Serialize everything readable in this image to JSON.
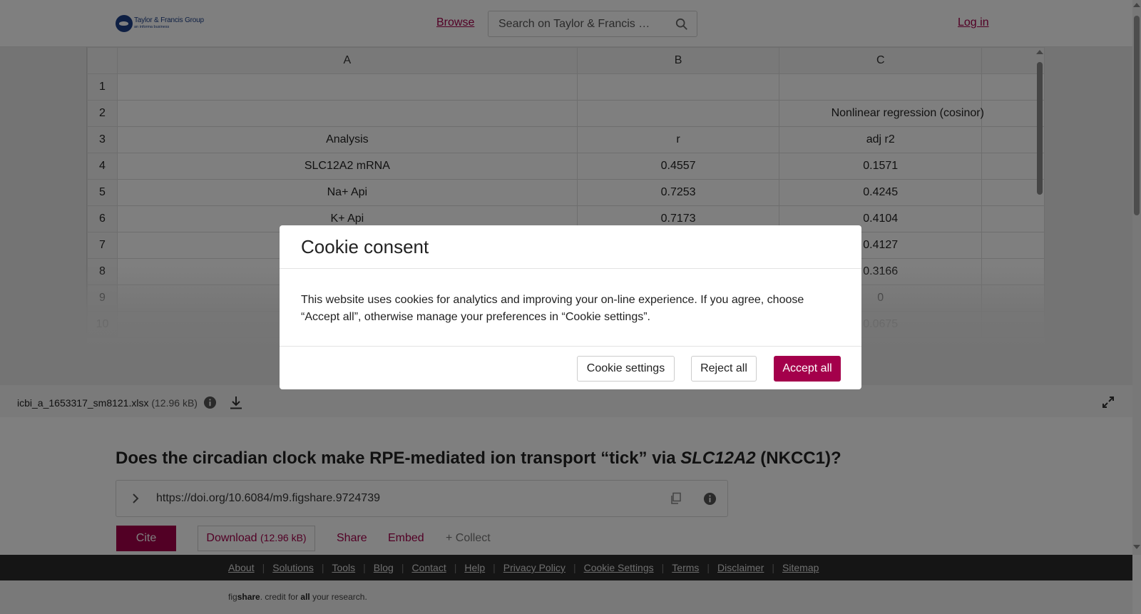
{
  "header": {
    "logo_line1": "Taylor & Francis Group",
    "logo_line2": "an informa business",
    "browse": "Browse",
    "search_placeholder": "Search on Taylor & Francis …",
    "login": "Log in"
  },
  "sheet": {
    "columns": [
      "A",
      "B",
      "C"
    ],
    "rows": [
      {
        "n": "1",
        "a": "",
        "b": "",
        "c": ""
      },
      {
        "n": "2",
        "a": "",
        "b": "",
        "c": "Nonlinear regression (cosinor)"
      },
      {
        "n": "3",
        "a": "Analysis",
        "b": "r",
        "c": "adj r2"
      },
      {
        "n": "4",
        "a": "SLC12A2 mRNA",
        "b": "0.4557",
        "c": "0.1571"
      },
      {
        "n": "5",
        "a": "Na+ Api",
        "b": "0.7253",
        "c": "0.4245"
      },
      {
        "n": "6",
        "a": "K+ Api",
        "b": "0.7173",
        "c": "0.4104"
      },
      {
        "n": "7",
        "a": "",
        "b": "",
        "c": "0.4127"
      },
      {
        "n": "8",
        "a": "",
        "b": "",
        "c": "0.3166"
      },
      {
        "n": "9",
        "a": "",
        "b": "",
        "c": "0"
      },
      {
        "n": "10",
        "a": "",
        "b": "",
        "c": "0.0675"
      }
    ]
  },
  "file": {
    "name": "icbi_a_1653317_sm8121.xlsx",
    "size": "(12.96 kB)"
  },
  "article": {
    "title_part1": "Does the circadian clock make RPE-mediated ion transport “tick” via ",
    "title_italic": "SLC12A2",
    "title_part2": " (NKCC1)?",
    "doi": "https://doi.org/10.6084/m9.figshare.9724739",
    "cite": "Cite",
    "download": "Download",
    "download_size": "(12.96 kB)",
    "share": "Share",
    "embed": "Embed",
    "collect": "+ Collect"
  },
  "footer": {
    "links": [
      "About",
      "Solutions",
      "Tools",
      "Blog",
      "Contact",
      "Help",
      "Privacy Policy",
      "Cookie Settings",
      "Terms",
      "Disclaimer",
      "Sitemap"
    ],
    "tag_fig": "fig",
    "tag_share": "share",
    "tag_mid": ". credit for ",
    "tag_all": "all",
    "tag_end": " your research."
  },
  "cookie": {
    "title": "Cookie consent",
    "body": "This website uses cookies for analytics and improving your on-line experience. If you agree, choose “Accept all”, otherwise manage your preferences in “Cookie settings”.",
    "settings": "Cookie settings",
    "reject": "Reject all",
    "accept": "Accept all"
  },
  "colors": {
    "brand": "#a4004b",
    "logo_blue": "#1c3f87",
    "footer_dark": "#2a2a2a"
  }
}
